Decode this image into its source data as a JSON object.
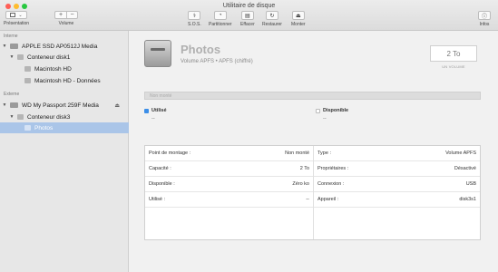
{
  "window": {
    "title": "Utilitaire de disque"
  },
  "toolbar": {
    "presentation": "Présentation",
    "volume": "Volume",
    "plus": "+",
    "minus": "−",
    "sos": "S.O.S.",
    "partition": "Partitionner",
    "erase": "Effacer",
    "restore": "Restaurer",
    "mount": "Monter",
    "info": "Infos"
  },
  "sidebar": {
    "internal_header": "Interne",
    "external_header": "Externe",
    "items": [
      {
        "label": "APPLE SSD AP0512J Media"
      },
      {
        "label": "Conteneur disk1"
      },
      {
        "label": "Macintosh HD"
      },
      {
        "label": "Macintosh HD - Données"
      },
      {
        "label": "WD My Passport 259F Media"
      },
      {
        "label": "Conteneur disk3"
      },
      {
        "label": "Photos"
      }
    ]
  },
  "volume": {
    "name": "Photos",
    "subtitle": "Volume APFS • APFS (chiffré)",
    "size": "2 To",
    "size_label": "UN VOLUME",
    "bar_label": "Non monté",
    "used_label": "Utilisé",
    "used_value": "--",
    "free_label": "Disponible",
    "free_value": "--",
    "colors": {
      "used": "#3b8ee8",
      "free": "#ffffff"
    }
  },
  "info": {
    "left": [
      {
        "k": "Point de montage :",
        "v": "Non monté"
      },
      {
        "k": "Capacité :",
        "v": "2 To"
      },
      {
        "k": "Disponible :",
        "v": "Zéro ko"
      },
      {
        "k": "Utilisé :",
        "v": "--"
      }
    ],
    "right": [
      {
        "k": "Type :",
        "v": "Volume APFS"
      },
      {
        "k": "Propriétaires :",
        "v": "Désactivé"
      },
      {
        "k": "Connexion :",
        "v": "USB"
      },
      {
        "k": "Appareil :",
        "v": "disk3s1"
      }
    ]
  }
}
